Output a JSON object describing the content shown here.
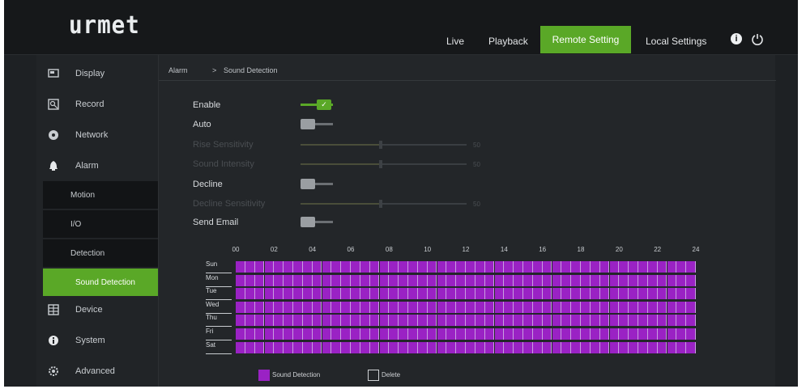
{
  "brand": {
    "logo": "urmet"
  },
  "header": {
    "tabs": [
      {
        "label": "Live",
        "active": false
      },
      {
        "label": "Playback",
        "active": false
      },
      {
        "label": "Remote Setting",
        "active": true
      },
      {
        "label": "Local Settings",
        "active": false
      }
    ],
    "info_icon": "info-icon",
    "power_icon": "power-icon"
  },
  "sidebar": {
    "items": [
      {
        "label": "Display",
        "icon": "display-icon"
      },
      {
        "label": "Record",
        "icon": "record-icon"
      },
      {
        "label": "Network",
        "icon": "network-icon"
      },
      {
        "label": "Alarm",
        "icon": "alarm-icon"
      },
      {
        "label": "Device",
        "icon": "device-icon"
      },
      {
        "label": "System",
        "icon": "system-icon"
      },
      {
        "label": "Advanced",
        "icon": "advanced-icon"
      }
    ],
    "subitems": [
      {
        "label": "Motion",
        "active": false
      },
      {
        "label": "I/O",
        "active": false
      },
      {
        "label": "Detection",
        "active": false
      },
      {
        "label": "Sound Detection",
        "active": true
      }
    ]
  },
  "breadcrumb": {
    "home": "Alarm",
    "separator": ">",
    "page": "Sound Detection"
  },
  "settings": {
    "enable": {
      "label": "Enable",
      "on": true
    },
    "auto": {
      "label": "Auto",
      "on": false
    },
    "rise_sensitivity": {
      "label": "Rise Sensitivity",
      "value": "50"
    },
    "sound_intensity": {
      "label": "Sound Intensity",
      "value": "50"
    },
    "decline": {
      "label": "Decline",
      "on": false
    },
    "decline_sensitivity": {
      "label": "Decline Sensitivity",
      "value": "50"
    },
    "send_email": {
      "label": "Send Email",
      "on": false
    }
  },
  "schedule": {
    "hours": [
      "00",
      "02",
      "04",
      "06",
      "08",
      "10",
      "12",
      "14",
      "16",
      "18",
      "20",
      "22",
      "24"
    ],
    "days": [
      "Sun",
      "Mon",
      "Tue",
      "Wed",
      "Thu",
      "Fri",
      "Sat"
    ],
    "fill_color": "#9a22c4",
    "legend": {
      "sound_detection": "Sound Detection",
      "delete": "Delete"
    }
  },
  "colors": {
    "accent": "#5aa827",
    "schedule": "#9a22c4",
    "background": "#1e2124"
  }
}
